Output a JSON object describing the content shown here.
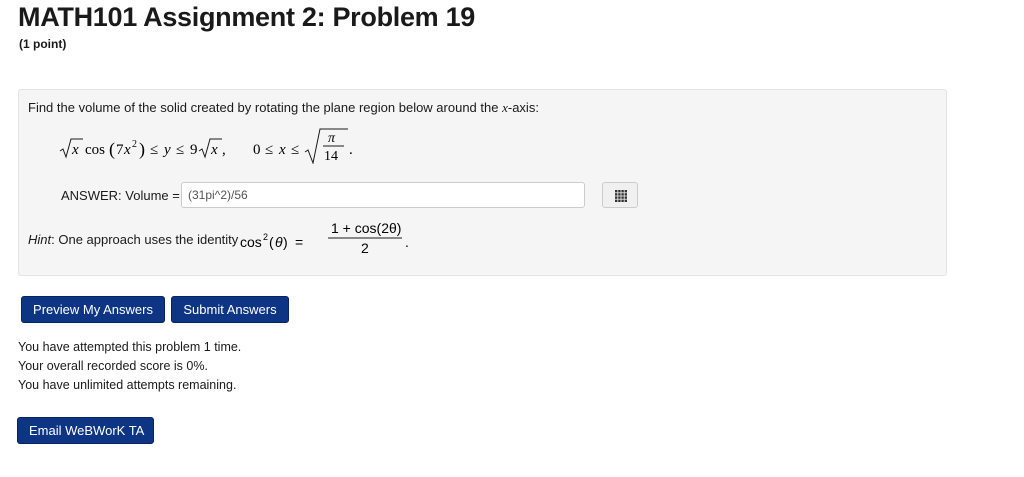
{
  "header": {
    "title": "MATH101 Assignment 2: Problem 19",
    "points": "(1 point)"
  },
  "problem": {
    "prompt_text": "Find the volume of the solid created by rotating the plane region below around the ",
    "prompt_axis_var": "x",
    "prompt_suffix": "-axis:",
    "inequality": {
      "cos": "cos",
      "coef": "7",
      "bound_coef": "9",
      "zero": "0",
      "pi": "π",
      "denom": "14",
      "x": "x",
      "y": "y"
    }
  },
  "answer": {
    "label": "ANSWER: Volume =",
    "value": "(31pi^2)/56"
  },
  "hint": {
    "label": "Hint",
    "text": ": One approach uses the identity ",
    "cos": "cos",
    "theta": "θ",
    "numerator": "1 + cos(2θ)",
    "denominator": "2"
  },
  "buttons": {
    "preview": "Preview My Answers",
    "submit": "Submit Answers",
    "email": "Email WeBWorK TA"
  },
  "status": {
    "attempts": "You have attempted this problem 1 time.",
    "score": "Your overall recorded score is 0%.",
    "remaining": "You have unlimited attempts remaining."
  },
  "colors": {
    "button_bg": "#0d3584",
    "panel_bg": "#f5f5f5"
  },
  "icons": {
    "equation_editor": "grid-icon"
  }
}
